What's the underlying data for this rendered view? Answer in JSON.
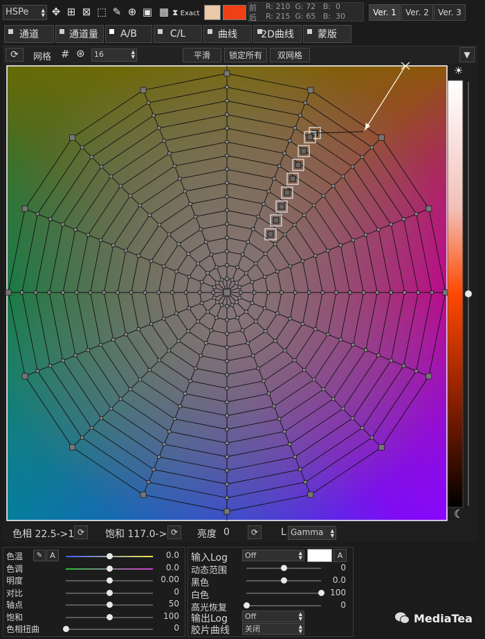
{
  "toolbar": {
    "mode": "HSPe",
    "exact": "Exact",
    "front_label": "前",
    "back_label": "后",
    "front_rgb": "R: 210  G: 72   B:  0",
    "back_rgb": "R: 215  G: 65   B:  30",
    "swatch_front": "#e9c9a8",
    "swatch_back": "#ef3f14",
    "versions": [
      "Ver. 1",
      "Ver. 2",
      "Ver. 3"
    ]
  },
  "tabs": [
    "通道",
    "通道量",
    "A/B",
    "C/L",
    "曲线",
    "2D曲线",
    "蒙版"
  ],
  "grid_bar": {
    "grid_label": "网格",
    "grid_value": "16",
    "smooth": "平滑",
    "lock_all": "锁定所有",
    "dual_grid": "双网格"
  },
  "status": {
    "hue": "色相 22.5->1",
    "sat": "饱和 117.0->",
    "brightness_label": "亮度",
    "brightness_value": "0",
    "l_label": "L",
    "gamma": "Gamma"
  },
  "left_sliders": [
    {
      "label": "色温",
      "value": "0.0",
      "pos": 0.5
    },
    {
      "label": "色调",
      "value": "0.0",
      "pos": 0.5
    },
    {
      "label": "明度",
      "value": "0.00",
      "pos": 0.5
    },
    {
      "label": "对比",
      "value": "0",
      "pos": 0.5
    },
    {
      "label": "轴点",
      "value": "50",
      "pos": 0.5
    },
    {
      "label": "饱和",
      "value": "100",
      "pos": 0.5
    },
    {
      "label": "色相扭曲",
      "value": "0",
      "pos": 0.0
    }
  ],
  "right_panel": {
    "input_log": "输入Log",
    "input_log_value": "Off",
    "a_button": "A",
    "dynamic_range": {
      "label": "动态范围",
      "value": "0",
      "pos": 0.5
    },
    "black": {
      "label": "黑色",
      "value": "0.0",
      "pos": 0.5
    },
    "white": {
      "label": "白色",
      "value": "100",
      "pos": 1.0
    },
    "highlight": {
      "label": "高光恢复",
      "value": "0",
      "pos": 0.0
    },
    "output_log": "输出Log",
    "output_log_value": "Off",
    "film_curve": "胶片曲线",
    "film_curve_value": "关闭"
  },
  "watermark": "MediaTea"
}
